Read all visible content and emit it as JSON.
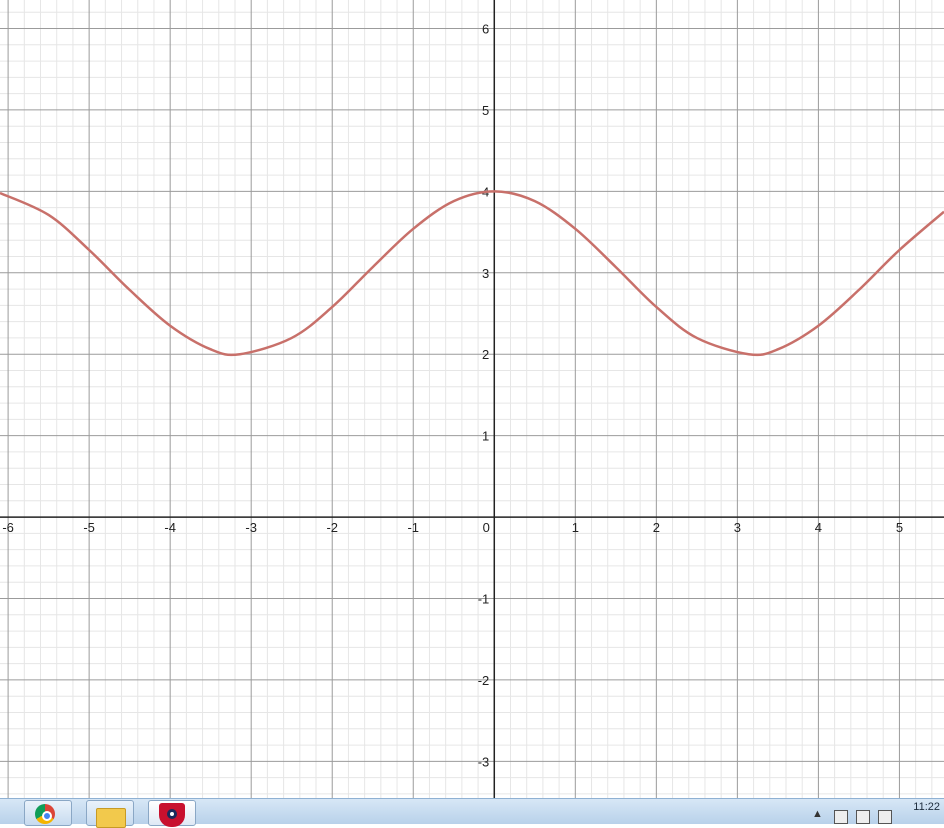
{
  "chart_data": {
    "type": "line",
    "title": "",
    "xlabel": "",
    "ylabel": "",
    "xlim": [
      -6.1,
      5.55
    ],
    "ylim": [
      -3.45,
      6.35
    ],
    "x_ticks": [
      -6,
      -5,
      -4,
      -3,
      -2,
      -1,
      0,
      1,
      2,
      3,
      4,
      5
    ],
    "y_ticks": [
      -3,
      -2,
      -1,
      1,
      2,
      3,
      4,
      5,
      6
    ],
    "x_tick_labels": [
      "-6",
      "-5",
      "-4",
      "-3",
      "-2",
      "-1",
      "0",
      "1",
      "2",
      "3",
      "4",
      "5"
    ],
    "y_tick_labels": [
      "-3",
      "-2",
      "-1",
      "1",
      "2",
      "3",
      "4",
      "5",
      "6"
    ],
    "grid": true,
    "series": [
      {
        "color": "#c8706a",
        "x": [
          -6.1,
          -5.5,
          -5.0,
          -4.5,
          -4.0,
          -3.5,
          -3.14,
          -2.5,
          -2.0,
          -1.5,
          -1.0,
          -0.5,
          0.0,
          0.5,
          1.0,
          1.5,
          2.0,
          2.5,
          3.14,
          3.5,
          4.0,
          4.5,
          5.0,
          5.55
        ],
        "y": [
          3.98,
          3.71,
          3.28,
          2.79,
          2.35,
          2.06,
          2.0,
          2.2,
          2.58,
          3.07,
          3.54,
          3.88,
          4.0,
          3.88,
          3.54,
          3.07,
          2.58,
          2.2,
          2.0,
          2.06,
          2.35,
          2.79,
          3.28,
          3.75
        ]
      }
    ]
  },
  "taskbar": {
    "apps": [
      {
        "name": "chrome-icon"
      },
      {
        "name": "folder-icon"
      },
      {
        "name": "shield-icon"
      }
    ],
    "tray_arrow": "▲",
    "clock": "11:22"
  }
}
